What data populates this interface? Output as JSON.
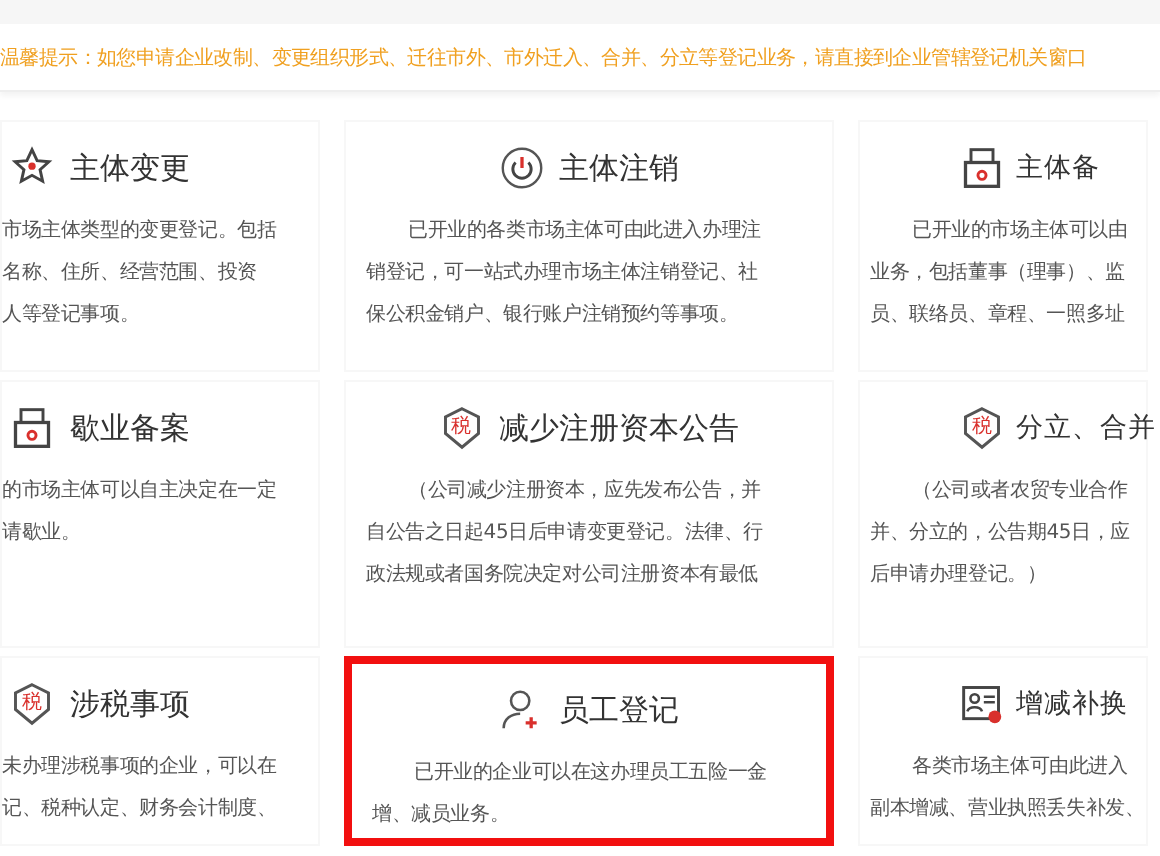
{
  "notice": "温馨提示：如您申请企业改制、变更组织形式、迁往市外、市外迁入、合并、分立等登记业务，请直接到企业管辖登记机关窗口",
  "cards": [
    {
      "title": "主体变更",
      "kind": "star-edit",
      "highlighted": false,
      "lines": [
        "市场主体类型的变更登记。包括",
        "名称、住所、经营范围、投资",
        "人等登记事项。"
      ]
    },
    {
      "title": "主体注销",
      "kind": "power",
      "highlighted": false,
      "lines": [
        "已开业的各类市场主体可由此进入办理注",
        "销登记，可一站式办理市场主体注销登记、社",
        "保公积金销户、银行账户注销预约等事项。"
      ]
    },
    {
      "title": "主体备",
      "kind": "printer",
      "highlighted": false,
      "lines": [
        "已开业的市场主体可以由",
        "业务，包括董事（理事）、监",
        "员、联络员、章程、一照多址"
      ]
    },
    {
      "title": "歇业备案",
      "kind": "printer",
      "highlighted": false,
      "lines": [
        "的市场主体可以自主决定在一定",
        "请歇业。"
      ]
    },
    {
      "title": "减少注册资本公告",
      "kind": "tax-shield",
      "icon_glyph": "税",
      "highlighted": false,
      "lines": [
        "（公司减少注册资本，应先发布公告，并",
        "自公告之日起45日后申请变更登记。法律、行",
        "政法规或者国务院决定对公司注册资本有最低"
      ]
    },
    {
      "title": "分立、合并",
      "kind": "tax-shield",
      "icon_glyph": "税",
      "highlighted": false,
      "lines": [
        "（公司或者农贸专业合作",
        "并、分立的，公告期45日，应",
        "后申请办理登记。）"
      ]
    },
    {
      "title": "涉税事项",
      "kind": "tax-shield",
      "icon_glyph": "税",
      "highlighted": false,
      "lines": [
        "未办理涉税事项的企业，可以在",
        "记、税种认定、财务会计制度、"
      ]
    },
    {
      "title": "员工登记",
      "kind": "user-add",
      "highlighted": true,
      "lines": [
        "已开业的企业可以在这办理员工五险一金",
        "增、减员业务。"
      ]
    },
    {
      "title": "增减补换",
      "kind": "id-card",
      "highlighted": false,
      "lines": [
        "各类市场主体可由此进入",
        "副本增减、营业执照丢失补发、"
      ]
    }
  ]
}
